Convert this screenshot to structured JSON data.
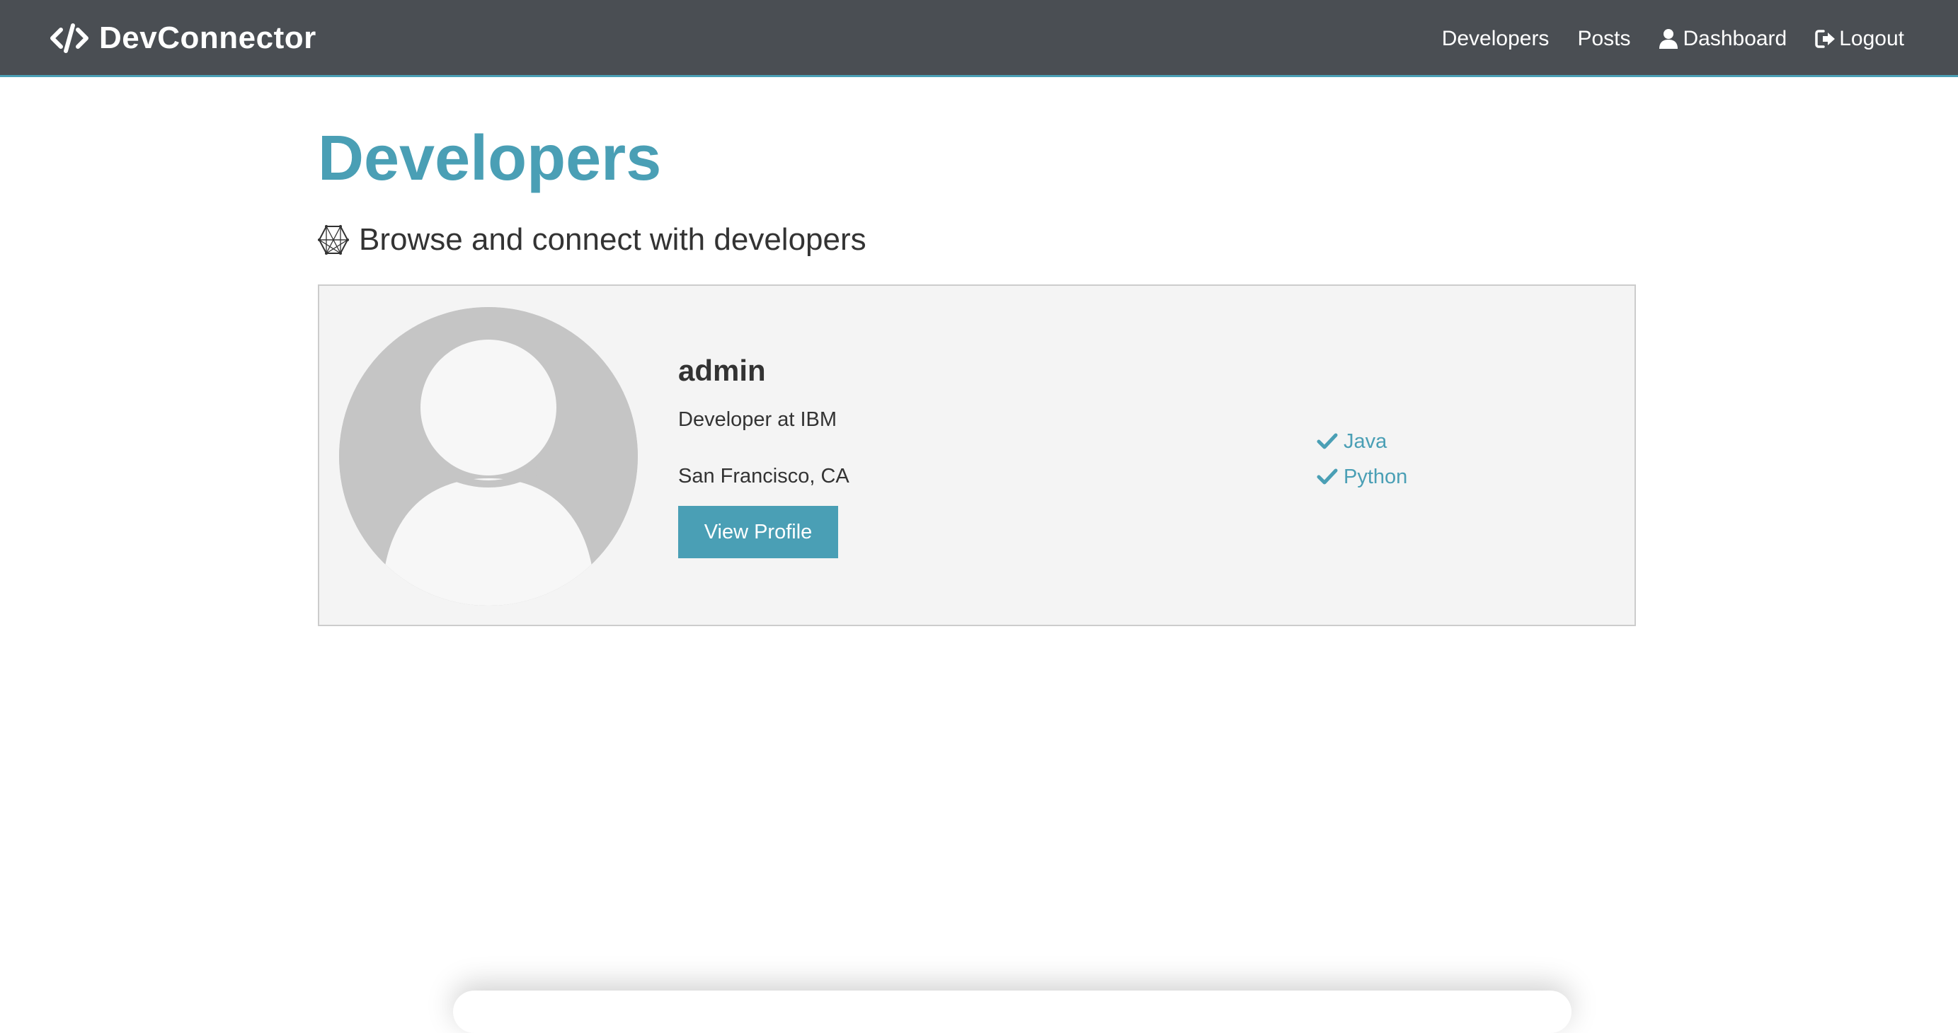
{
  "navbar": {
    "brand": "DevConnector",
    "brand_icon": "code-icon",
    "links": [
      {
        "label": "Developers",
        "icon": ""
      },
      {
        "label": "Posts",
        "icon": ""
      },
      {
        "label": "Dashboard",
        "icon": "user-icon"
      },
      {
        "label": "Logout",
        "icon": "sign-out-icon"
      }
    ]
  },
  "page": {
    "title": "Developers",
    "lead": "Browse and connect with developers",
    "lead_icon": "connectdevelop-icon"
  },
  "profiles": [
    {
      "name": "admin",
      "status": "Developer at IBM",
      "location": "San Francisco, CA",
      "button_label": "View Profile",
      "skills": [
        "Java",
        "Python"
      ]
    }
  ],
  "colors": {
    "primary": "#4a9fb5",
    "navbar": "#4a4e53",
    "card_bg": "#f4f4f4",
    "avatar_bg": "#c5c5c5"
  }
}
